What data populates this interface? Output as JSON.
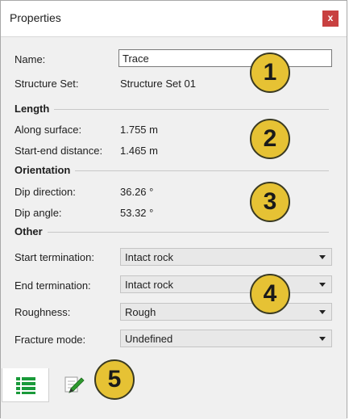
{
  "window": {
    "title": "Properties",
    "close_label": "x"
  },
  "fields": {
    "name_label": "Name:",
    "name_value": "Trace",
    "structure_set_label": "Structure Set:",
    "structure_set_value": "Structure Set 01"
  },
  "length": {
    "heading": "Length",
    "along_surface_label": "Along surface:",
    "along_surface_value": "1.755 m",
    "start_end_label": "Start-end distance:",
    "start_end_value": "1.465 m"
  },
  "orientation": {
    "heading": "Orientation",
    "dip_direction_label": "Dip direction:",
    "dip_direction_value": "36.26 °",
    "dip_angle_label": "Dip angle:",
    "dip_angle_value": "53.32 °"
  },
  "other": {
    "heading": "Other",
    "start_termination_label": "Start termination:",
    "start_termination_value": "Intact rock",
    "end_termination_label": "End termination:",
    "end_termination_value": "Intact rock",
    "roughness_label": "Roughness:",
    "roughness_value": "Rough",
    "fracture_mode_label": "Fracture mode:",
    "fracture_mode_value": "Undefined"
  },
  "callouts": [
    "1",
    "2",
    "3",
    "4",
    "5"
  ],
  "tabs": [
    {
      "icon": "list-icon",
      "active": true
    },
    {
      "icon": "edit-pencil-icon",
      "active": false
    }
  ],
  "colors": {
    "callout": "#e6c234",
    "close": "#c84040",
    "list_icon": "#1a9a3a"
  }
}
